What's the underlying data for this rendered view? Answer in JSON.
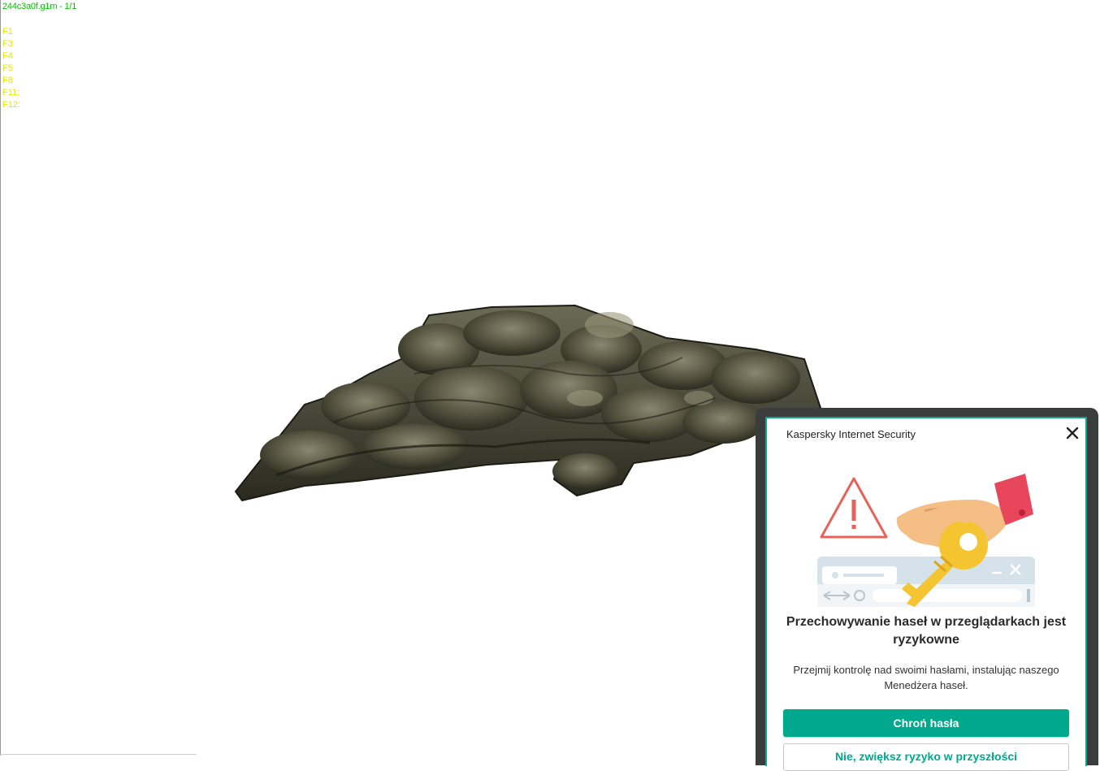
{
  "viewer": {
    "title": "244c3a0f.g1m - 1/1",
    "fkeys": [
      "F1",
      "F3",
      "F4",
      "F5",
      "F8",
      "F11:",
      "F12:"
    ],
    "model_description": "textured rock terrain mesh"
  },
  "popup": {
    "title": "Kaspersky Internet Security",
    "headline": "Przechowywanie haseł w przeglądarkach jest ryzykowne",
    "description": "Przejmij kontrolę nad swoimi hasłami, instalując naszego Menedżera haseł.",
    "primary_button": "Chroń hasła",
    "secondary_button": "Nie, zwiększ ryzyko w przyszłości",
    "accent_color": "#00a88e"
  },
  "icons": [
    "close-icon",
    "warning-triangle-icon",
    "hand-with-key-icon",
    "browser-window-icon"
  ]
}
